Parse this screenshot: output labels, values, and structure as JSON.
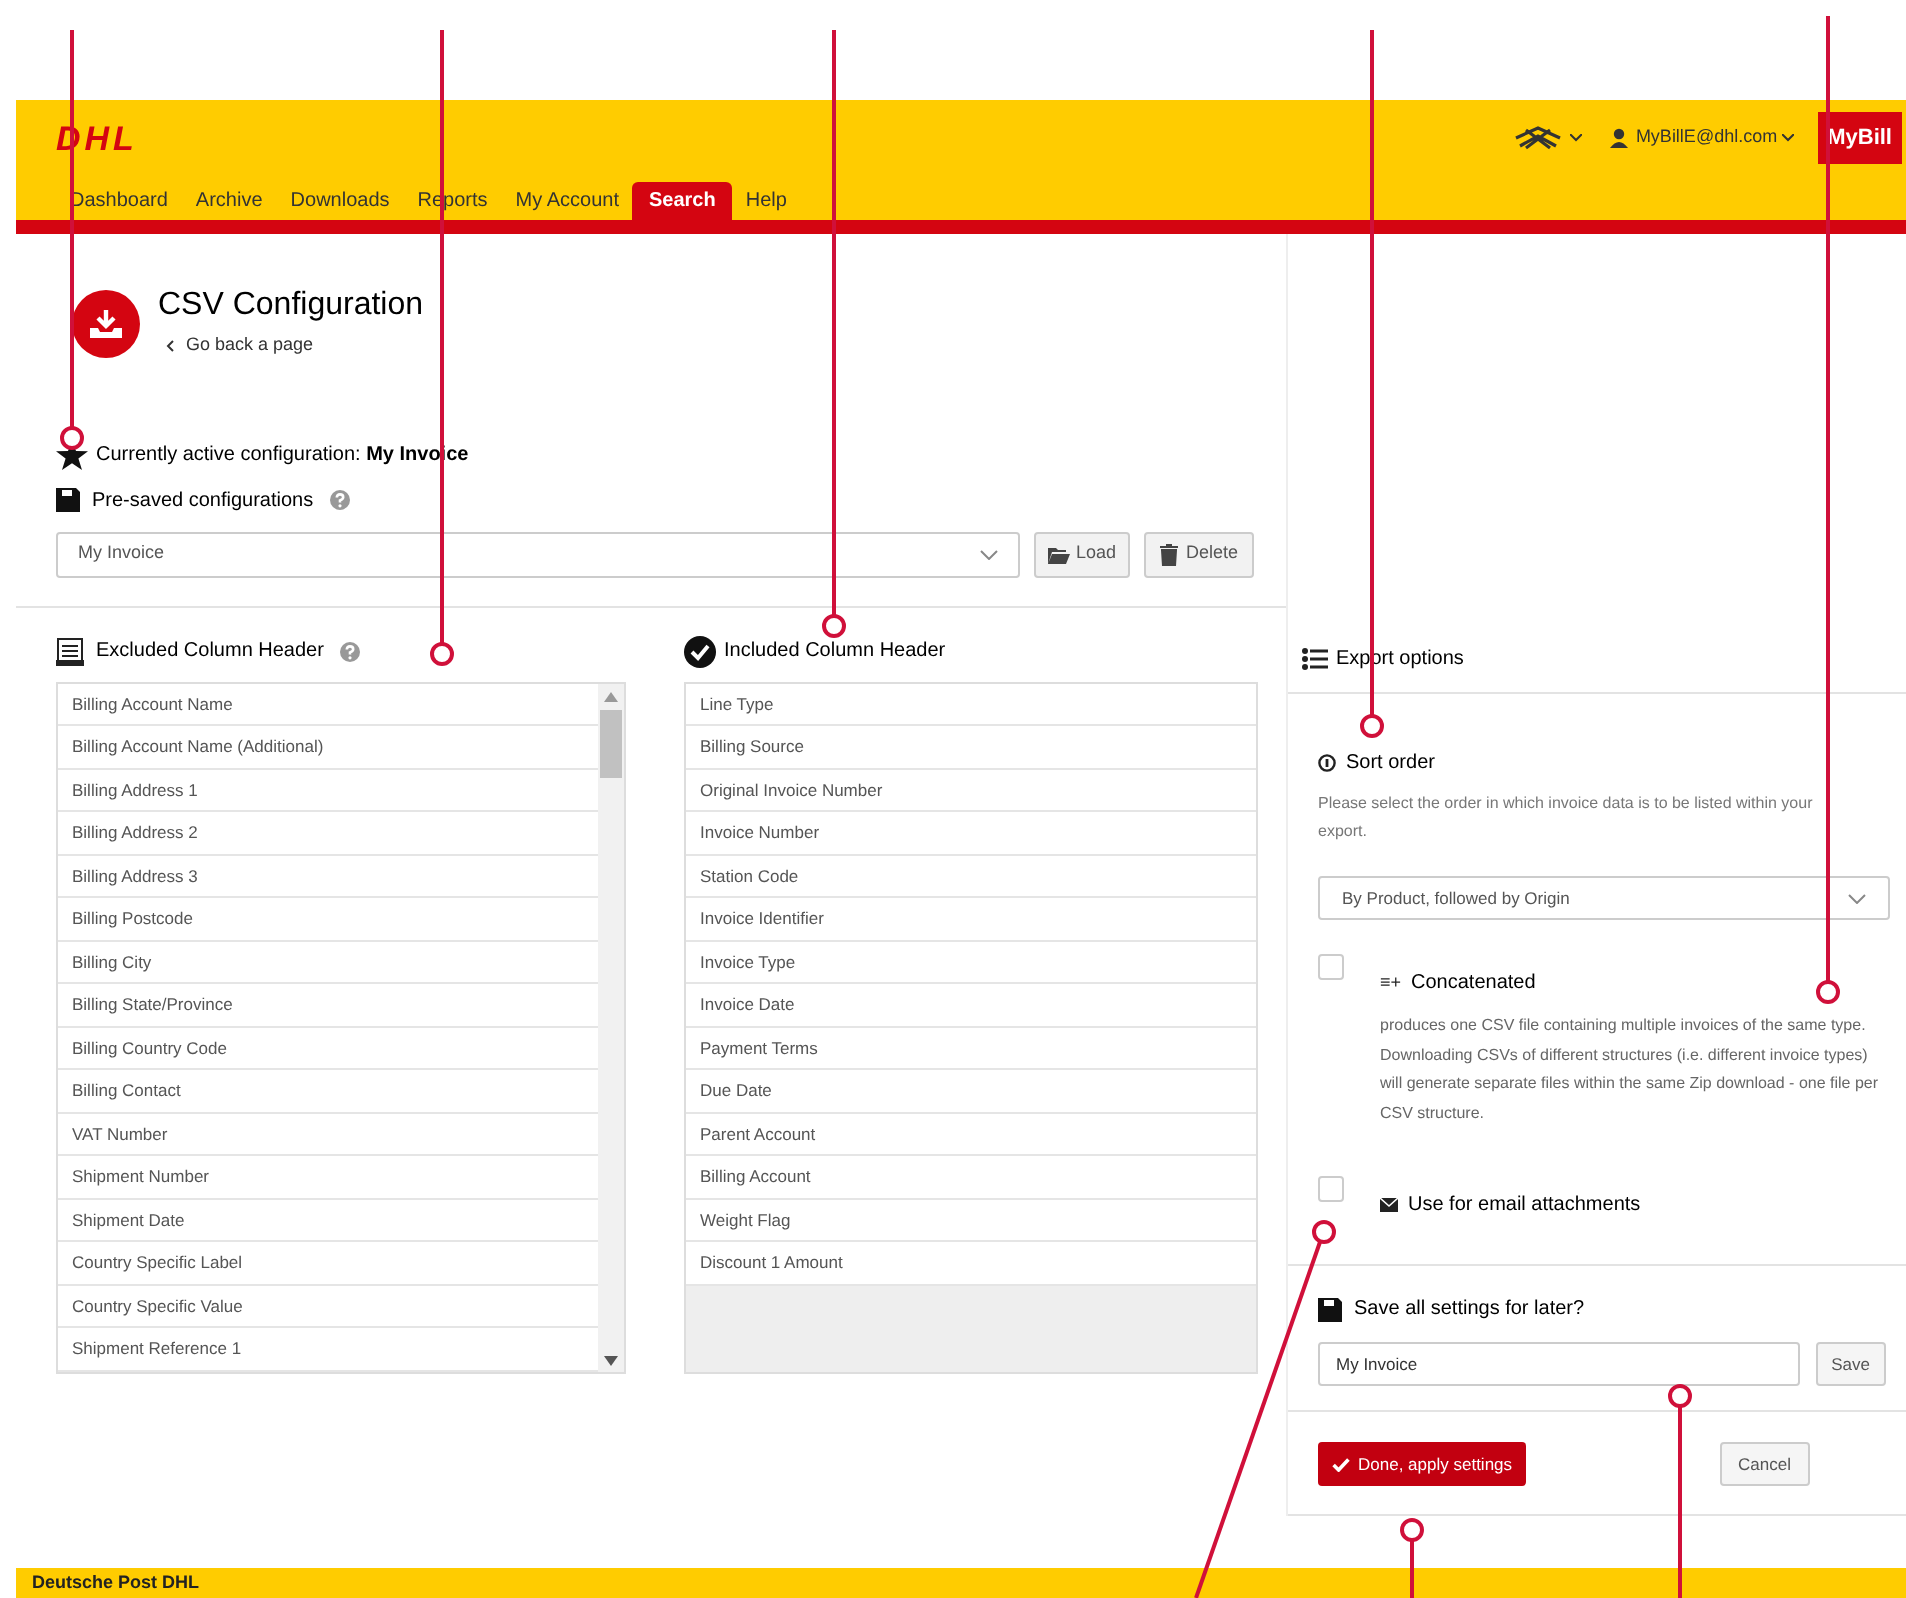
{
  "header": {
    "logo": "DHL",
    "user": "MyBillE@dhl.com",
    "app_badge": "MyBill"
  },
  "nav": [
    {
      "label": "Dashboard",
      "selected": false
    },
    {
      "label": "Archive",
      "selected": false
    },
    {
      "label": "Downloads",
      "selected": false
    },
    {
      "label": "Reports",
      "selected": false
    },
    {
      "label": "My Account",
      "selected": false
    },
    {
      "label": "Search",
      "selected": true
    },
    {
      "label": "Help",
      "selected": false
    }
  ],
  "page": {
    "title": "CSV Configuration",
    "back_link": "Go back a page"
  },
  "active_configuration": "Currently active configuration: **My Invoice**",
  "presaved": {
    "label": "Pre-saved configurations",
    "value": "My Invoice",
    "load": "Load",
    "delete": "Delete"
  },
  "excluded": {
    "title": "Excluded Column Header",
    "items": [
      "Billing Account Name",
      "Billing Account Name (Additional)",
      "Billing Address 1",
      "Billing Address 2",
      "Billing Address 3",
      "Billing Postcode",
      "Billing City",
      "Billing State/Province",
      "Billing Country Code",
      "Billing Contact",
      "VAT Number",
      "Shipment Number",
      "Shipment Date",
      "Country Specific Label",
      "Country Specific Value",
      "Shipment Reference 1"
    ]
  },
  "included": {
    "title": "Included Column Header",
    "items": [
      "Line Type",
      "Billing Source",
      "Original Invoice Number",
      "Invoice Number",
      "Station Code",
      "Invoice Identifier",
      "Invoice Type",
      "Invoice Date",
      "Payment Terms",
      "Due Date",
      "Parent Account",
      "Billing Account",
      "Weight Flag",
      "Discount 1 Amount"
    ]
  },
  "export_options": {
    "title": "Export options",
    "sort_title": "Sort order",
    "sort_help": "Please select the order in which invoice data is to be listed within your export.",
    "sort_value": "By Product, followed by Origin",
    "options": [
      {
        "icon": "≡+",
        "label": "Concatenated",
        "checked": false,
        "description": "produces one CSV file containing multiple invoices of the same type. Downloading CSVs of different structures (i.e. different invoice types) will generate separate files within the same Zip download - one file per CSV structure."
      },
      {
        "label": "Use for email attachments",
        "checked": false
      }
    ],
    "save_title": "Save all settings for later?",
    "save_value": "My Invoice",
    "save_button": "Save",
    "done": "Done, apply settings",
    "cancel": "Cancel"
  },
  "footer": "Deutsche Post DHL"
}
